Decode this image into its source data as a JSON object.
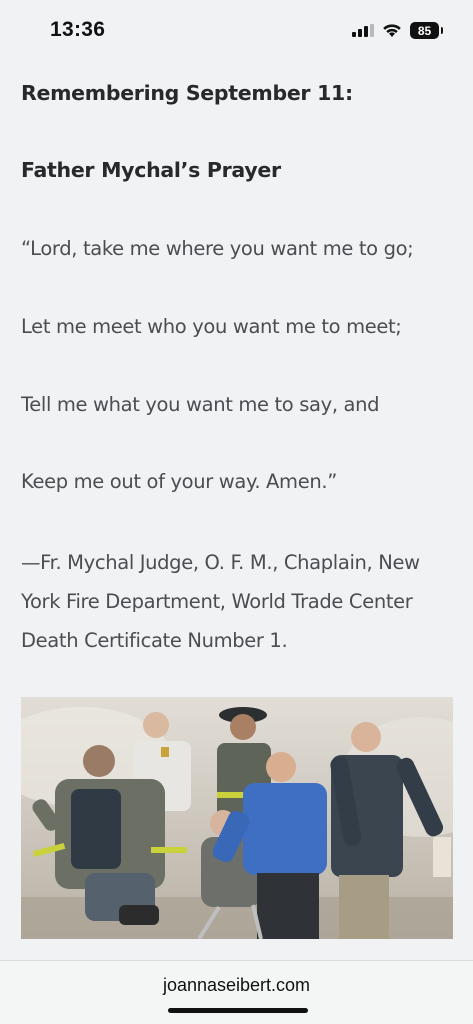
{
  "status_bar": {
    "time": "13:36",
    "battery": "85",
    "icons": [
      "cellular-signal-icon",
      "wifi-icon",
      "battery-icon"
    ]
  },
  "article": {
    "title": "Remembering September 11:",
    "subtitle": "Father Mychal’s Prayer",
    "prayer_lines": [
      "“Lord, take me where you want me to go;",
      "Let me meet who you want me to meet;",
      "Tell me what you want me to say, and",
      "Keep me out of your way. Amen.”"
    ],
    "attribution": "—Fr. Mychal Judge, O. F. M., Chaplain, New York Fire Department, World Trade Center Death Certificate Number 1."
  },
  "photo": {
    "colors": {
      "sky": "#d8d4cc",
      "dust": "#bdb6aa",
      "turnout_coat": "#6b6f64",
      "reflective_stripe": "#c9d23a",
      "blue_shirt": "#3e6fc2",
      "dark_jacket": "#3a4550"
    }
  },
  "browser": {
    "url": "joannaseibert.com"
  },
  "colors": {
    "background": "#f0f2f3",
    "heading": "#27292b",
    "body_text": "#4a4e52"
  }
}
